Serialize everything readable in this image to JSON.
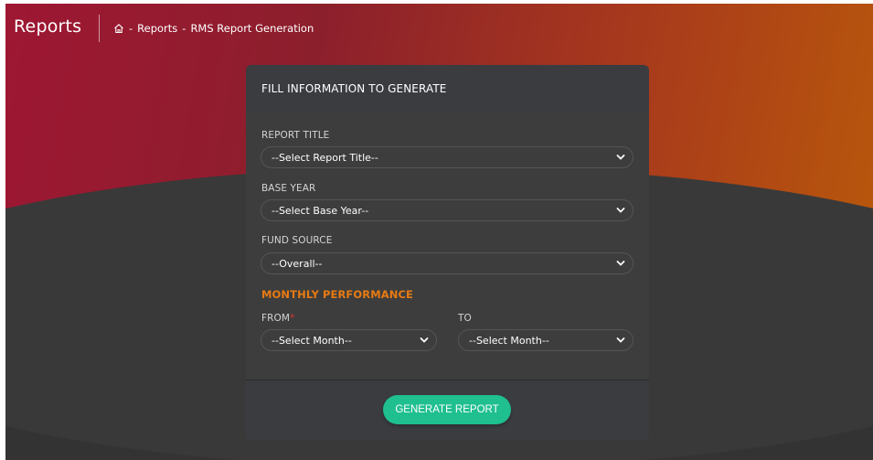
{
  "header": {
    "title": "Reports",
    "breadcrumb": {
      "home_icon": "home-icon",
      "separator": "-",
      "items": [
        "Reports",
        "RMS Report Generation"
      ]
    }
  },
  "form": {
    "card_title": "FILL INFORMATION TO GENERATE",
    "report_title": {
      "label": "REPORT TITLE",
      "selected": "--Select Report Title--"
    },
    "base_year": {
      "label": "BASE YEAR",
      "selected": "--Select Base Year--"
    },
    "fund_source": {
      "label": "FUND SOURCE",
      "selected": "--Overall--"
    },
    "monthly_performance": {
      "title": "MONTHLY PERFORMANCE",
      "from_label": "FROM",
      "required_marker": "*",
      "from_selected": "--Select Month--",
      "to_label": "TO",
      "to_selected": "--Select Month--"
    },
    "generate_button": "GENERATE REPORT"
  },
  "colors": {
    "accent": "#1fbf8f",
    "section_title": "#e87a12",
    "required": "#e0342b",
    "hero_start": "#9e1733",
    "hero_end": "#b8570c"
  }
}
